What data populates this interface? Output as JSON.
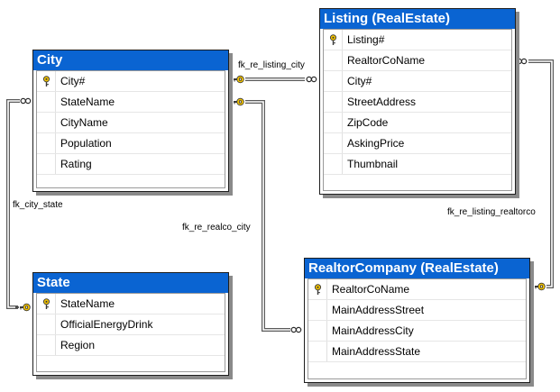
{
  "tables": {
    "city": {
      "title": "City",
      "columns": [
        {
          "name": "City#",
          "primary_key": true
        },
        {
          "name": "StateName",
          "primary_key": false
        },
        {
          "name": "CityName",
          "primary_key": false
        },
        {
          "name": "Population",
          "primary_key": false
        },
        {
          "name": "Rating",
          "primary_key": false
        }
      ]
    },
    "state": {
      "title": "State",
      "columns": [
        {
          "name": "StateName",
          "primary_key": true
        },
        {
          "name": "OfficialEnergyDrink",
          "primary_key": false
        },
        {
          "name": "Region",
          "primary_key": false
        }
      ]
    },
    "listing": {
      "title": "Listing (RealEstate)",
      "columns": [
        {
          "name": "Listing#",
          "primary_key": true
        },
        {
          "name": "RealtorCoName",
          "primary_key": false
        },
        {
          "name": "City#",
          "primary_key": false
        },
        {
          "name": "StreetAddress",
          "primary_key": false
        },
        {
          "name": "ZipCode",
          "primary_key": false
        },
        {
          "name": "AskingPrice",
          "primary_key": false
        },
        {
          "name": "Thumbnail",
          "primary_key": false
        }
      ]
    },
    "realtor": {
      "title": "RealtorCompany (RealEstate)",
      "columns": [
        {
          "name": "RealtorCoName",
          "primary_key": true
        },
        {
          "name": "MainAddressStreet",
          "primary_key": false
        },
        {
          "name": "MainAddressCity",
          "primary_key": false
        },
        {
          "name": "MainAddressState",
          "primary_key": false
        }
      ]
    }
  },
  "relationships": {
    "fk_re_listing_city": "fk_re_listing_city",
    "fk_city_state": "fk_city_state",
    "fk_re_realco_city": "fk_re_realco_city",
    "fk_re_listing_realtorco": "fk_re_listing_realtorco"
  },
  "colors": {
    "title_bar": "#0a64d2",
    "key": "#f2c200",
    "connector": "#5a5a5a"
  }
}
